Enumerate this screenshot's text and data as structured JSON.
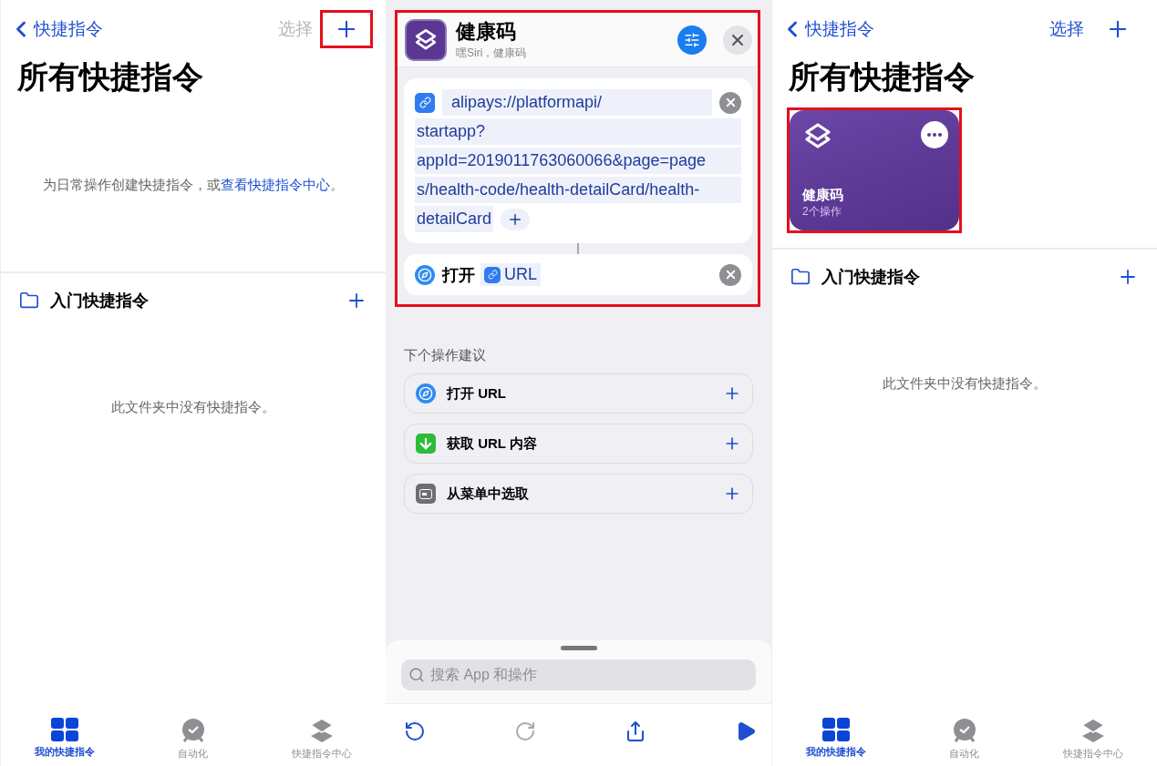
{
  "panels": [
    {
      "kind": "library",
      "back": "快捷指令",
      "select": {
        "label": "选择",
        "disabled": true
      },
      "add_highlighted": true,
      "title": "所有快捷指令",
      "empty_text": "为日常操作创建快捷指令，或",
      "empty_link": "查看快捷指令中心",
      "empty_end": "。",
      "folder": {
        "name": "入门快捷指令",
        "empty_text": "此文件夹中没有快捷指令。"
      },
      "tabs": [
        {
          "label": "我的快捷指令",
          "selected": true
        },
        {
          "label": "自动化",
          "selected": false
        },
        {
          "label": "快捷指令中心",
          "selected": false
        }
      ]
    },
    {
      "kind": "editor",
      "highlighted": true,
      "name": "健康码",
      "subtitle": "嘿Siri，健康码",
      "actions": [
        {
          "kind": "url",
          "lines": [
            "alipays://platformapi/",
            "startapp?",
            "appId=2019011763060066&page=page",
            "s/health-code/health-detailCard/health-",
            "detailCard"
          ]
        },
        {
          "kind": "open",
          "verb": "打开",
          "token": "URL"
        }
      ],
      "suggestions_title": "下个操作建议",
      "suggestions": [
        {
          "kind": "safari",
          "label": "打开 URL"
        },
        {
          "kind": "download",
          "label": "获取 URL 内容"
        },
        {
          "kind": "menu",
          "label": "从菜单中选取"
        }
      ],
      "search": {
        "placeholder": "搜索 App 和操作"
      },
      "toolbar": [
        {
          "kind": "undo",
          "disabled": false
        },
        {
          "kind": "redo",
          "disabled": true
        },
        {
          "kind": "share",
          "disabled": false
        },
        {
          "kind": "run",
          "disabled": false
        }
      ]
    },
    {
      "kind": "library",
      "back": "快捷指令",
      "select": {
        "label": "选择",
        "disabled": false
      },
      "add_highlighted": false,
      "title": "所有快捷指令",
      "shortcuts": [
        {
          "name": "健康码",
          "subtitle": "2个操作",
          "highlighted": true
        }
      ],
      "folder": {
        "name": "入门快捷指令",
        "empty_text": "此文件夹中没有快捷指令。"
      },
      "tabs": [
        {
          "label": "我的快捷指令",
          "selected": true
        },
        {
          "label": "自动化",
          "selected": false
        },
        {
          "label": "快捷指令中心",
          "selected": false
        }
      ]
    }
  ]
}
